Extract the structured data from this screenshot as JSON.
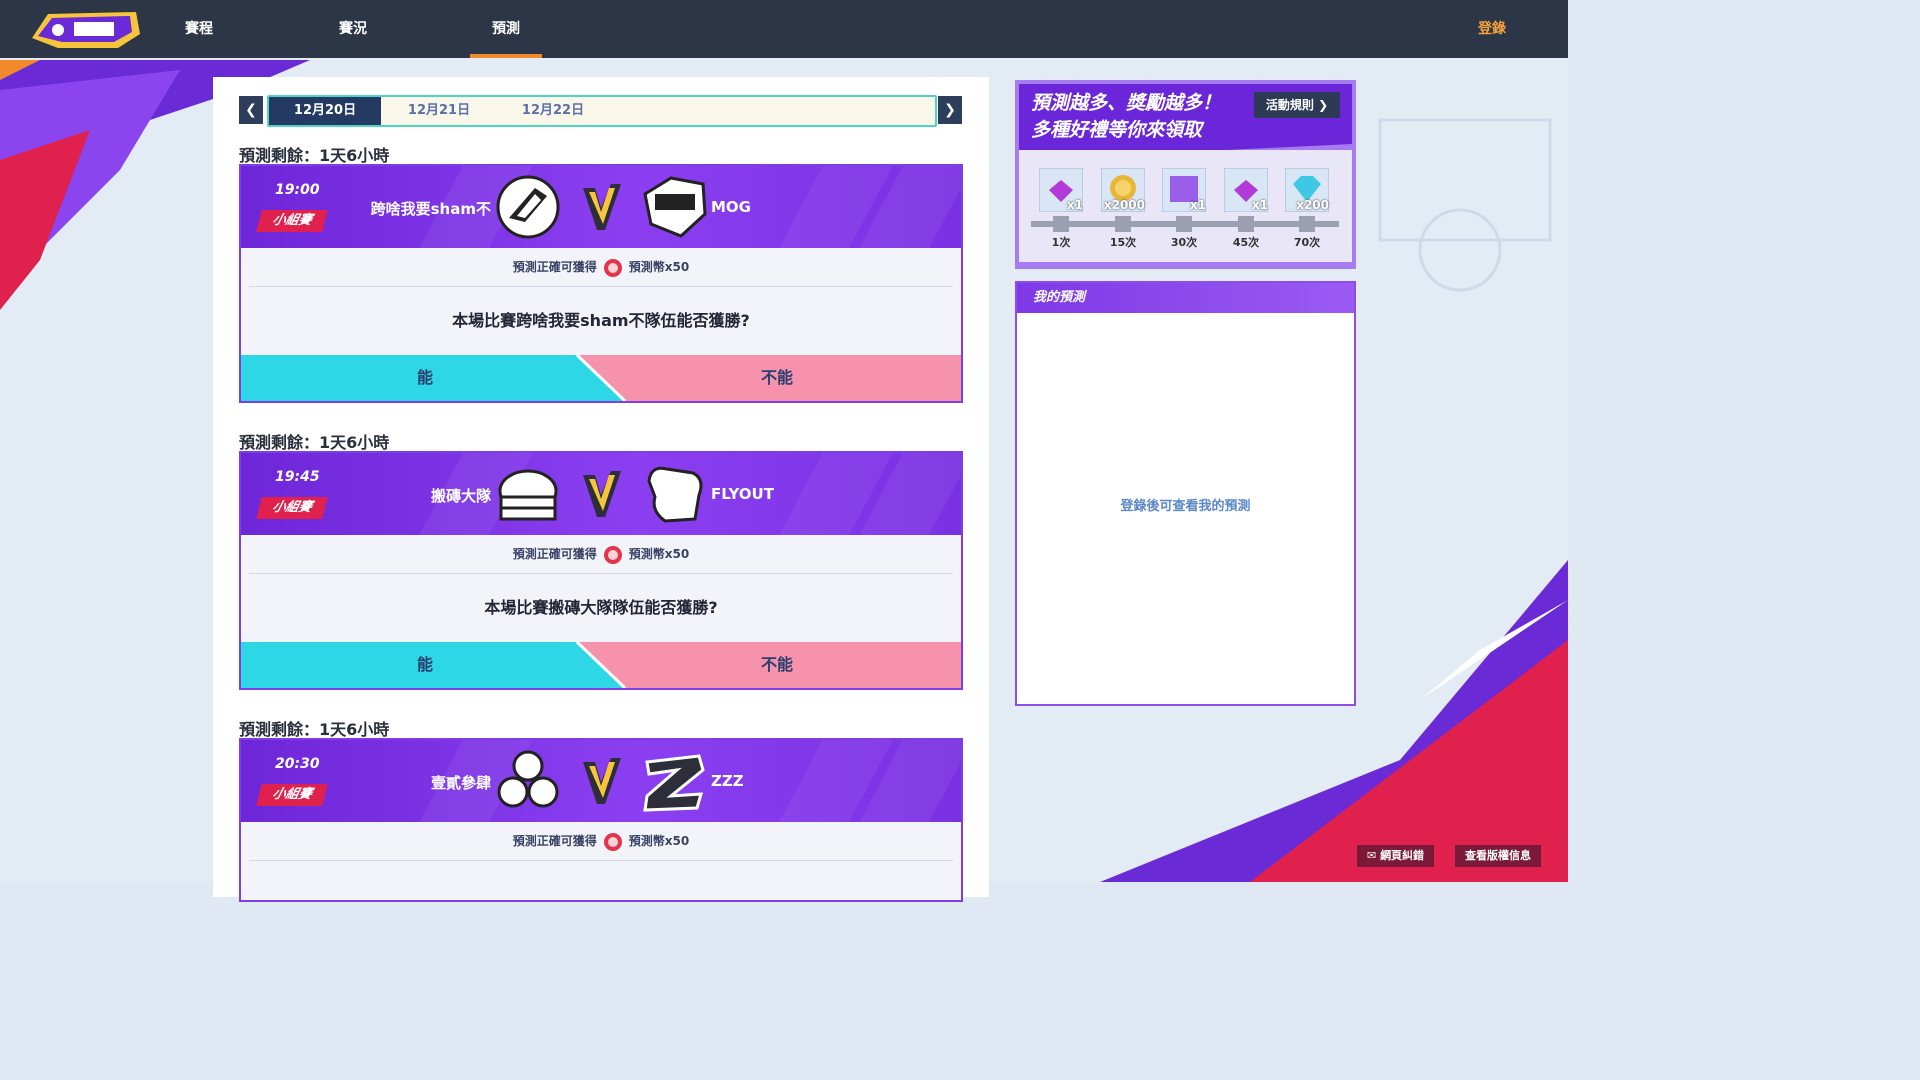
{
  "nav": {
    "items": [
      "賽程",
      "賽況",
      "預測"
    ],
    "active_index": 2,
    "login": "登錄"
  },
  "dates": {
    "tabs": [
      "12月20日",
      "12月21日",
      "12月22日"
    ],
    "active_index": 0
  },
  "matches": [
    {
      "countdown": "預測剩餘：1天6小時",
      "time": "19:00",
      "stage": "小組賽",
      "team_a": "跨啥我要sham不",
      "team_b": "MOG",
      "reward_prefix": "預測正確可獲得",
      "reward": "預測幣x50",
      "question": "本場比賽跨啥我要sham不隊伍能否獲勝?",
      "yes": "能",
      "no": "不能"
    },
    {
      "countdown": "預測剩餘：1天6小時",
      "time": "19:45",
      "stage": "小組賽",
      "team_a": "搬磚大隊",
      "team_b": "FLYOUT",
      "reward_prefix": "預測正確可獲得",
      "reward": "預測幣x50",
      "question": "本場比賽搬磚大隊隊伍能否獲勝?",
      "yes": "能",
      "no": "不能"
    },
    {
      "countdown": "預測剩餘：1天6小時",
      "time": "20:30",
      "stage": "小組賽",
      "team_a": "壹貳參肆",
      "team_b": "ZZZ",
      "reward_prefix": "預測正確可獲得",
      "reward": "預測幣x50"
    }
  ],
  "promo": {
    "title_line1": "預測越多、獎勵越多！",
    "title_line2": "多種好禮等你來領取",
    "rules_button": "活動規則",
    "rewards": [
      {
        "qty": "x1",
        "count": "1次",
        "icon": "purple-gem-icon"
      },
      {
        "qty": "x2000",
        "count": "15次",
        "icon": "gold-coin-icon"
      },
      {
        "qty": "x1",
        "count": "30次",
        "icon": "purple-card-icon"
      },
      {
        "qty": "x1",
        "count": "45次",
        "icon": "purple-gem-icon"
      },
      {
        "qty": "x200",
        "count": "70次",
        "icon": "diamond-icon"
      }
    ]
  },
  "my_predictions": {
    "title": "我的預測",
    "empty_text": "登錄後可查看我的預測"
  },
  "footer": {
    "report": "網頁糾錯",
    "copyright": "查看版權信息"
  },
  "colors": {
    "nav_bg": "#2c3647",
    "accent_orange": "#f08a2c",
    "card_purple": "#7e3ee5",
    "yes_cyan": "#2dd7e6",
    "no_pink": "#f692ab",
    "stage_red": "#e0204d"
  }
}
